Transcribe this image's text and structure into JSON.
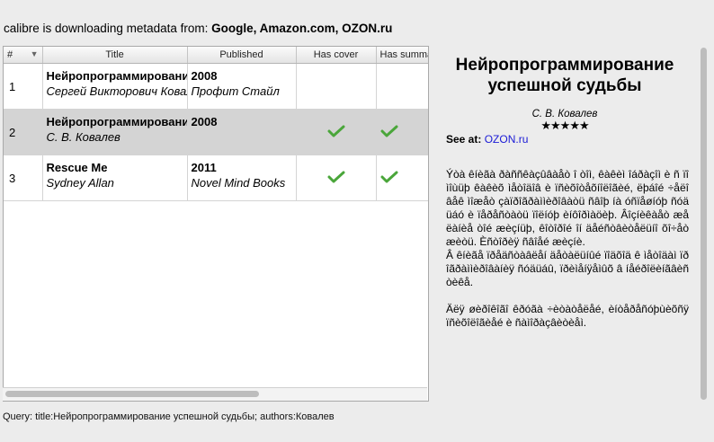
{
  "status": {
    "prefix": "calibre is downloading metadata from: ",
    "sources": [
      "Google",
      "Amazon.com",
      "OZON.ru"
    ]
  },
  "table": {
    "columns": [
      "#",
      "Title",
      "Published",
      "Has cover",
      "Has summary"
    ],
    "rows": [
      {
        "num": "1",
        "title": "Нейропрограммирование успешной судьбы",
        "author": "Сергей Викторович Ковалев",
        "year": "2008",
        "publisher": "Профит Стайл",
        "has_cover": false,
        "has_summary": false,
        "selected": false
      },
      {
        "num": "2",
        "title": "Нейропрограммирование успешной судьбы",
        "author": "С. В. Ковалев",
        "year": "2008",
        "publisher": "",
        "has_cover": true,
        "has_summary": true,
        "selected": true
      },
      {
        "num": "3",
        "title": "Rescue Me",
        "author": "Sydney Allan",
        "year": "2011",
        "publisher": "Novel Mind Books",
        "has_cover": true,
        "has_summary": true,
        "selected": false
      }
    ]
  },
  "details": {
    "title": "Нейропрограммирование успешной судьбы",
    "author": "С. В. Ковалев",
    "stars": "★★★★★",
    "see_at_label": "See at:",
    "see_at_link": "OZON.ru",
    "description": "Ýòà êíèãà ðàññêàçûâàåò î òîì, êàêèì îáðàçîì è ñ ïîìîùüþ êàêèõ ìåòîäîâ è ïñèõîòåõíîëîãèé, ëþáîé ÷åëîâåê ìîæåò çàïðîãðàììèðîâàòü ñâîþ íà óñïåøíóþ ñóäüáó è ïåðåñòàòü ïîëíóþ èíôîðìàöèþ. Âîçíèêàåò æåëàíèå òîé æèçíüþ, êîòîðîé îí äåéñòâèòåëüíî õî÷åò æèòü. Èñòîðèÿ ñâîåé æèçíè.\nÂ êíèãå ïðåäñòàâëåí äåòàëüíûé ïîäõîä ê ìåòîäàì ïðîãðàììèðîâàíèÿ ñóäüáû, ïðèìåíÿåìûõ â íåéðîëèíãâèñòèêå.\n\nÄëÿ øèðîêîãî êðóãà ÷èòàòåëåé, èíòåðåñóþùèõñÿ ïñèõîëîãèåé è ñàìîðàçâèòèåì."
  },
  "query": "Query: title:Нейропрограммирование успешной судьбы; authors:Ковалев",
  "colors": {
    "selected_row": "#d4d4d4",
    "check": "#4aa63a",
    "link": "#1a1ad6"
  },
  "icons": {
    "check": "check-icon",
    "sort": "sort-arrow-icon"
  }
}
